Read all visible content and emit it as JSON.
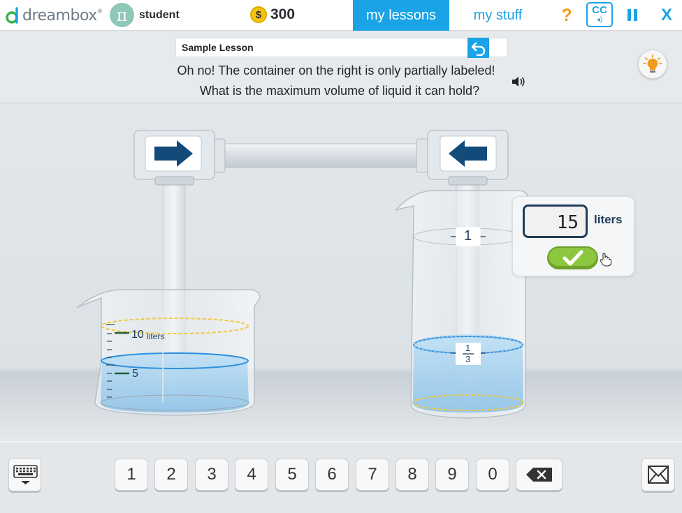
{
  "app": {
    "logo_text": "dreambox",
    "logo_tm": "®",
    "avatar_symbol": "π",
    "username": "student",
    "coin_symbol": "$",
    "coins": "300",
    "tabs": {
      "lessons": "my lessons",
      "stuff": "my stuff"
    },
    "help": "?",
    "cc_label": "CC",
    "close": "X"
  },
  "header": {
    "lesson_title": "Sample Lesson",
    "instruction_line1": "Oh no! The container on the right is only partially labeled!",
    "instruction_line2": "What is the maximum volume of liquid it can hold?"
  },
  "beakers": {
    "left": {
      "mark_top": "10",
      "mark_top_unit": "liters",
      "mark_mid": "5"
    },
    "right": {
      "mark_full": "1",
      "mark_fraction_num": "1",
      "mark_fraction_den": "3"
    }
  },
  "answer": {
    "value": "15",
    "unit": "liters"
  },
  "keypad": {
    "keys": [
      "1",
      "2",
      "3",
      "4",
      "5",
      "6",
      "7",
      "8",
      "9",
      "0"
    ]
  },
  "colors": {
    "accent": "#1aa3e6",
    "navy": "#1f3d5a",
    "check_green": "#8dc63f",
    "water": "#a9d4f0",
    "coin": "#f5c40f"
  },
  "icons": {
    "logo": "dreambox-d-icon",
    "undo": "undo-arrow-icon",
    "speaker": "speaker-icon",
    "hint": "lightbulb-icon",
    "check": "checkmark-icon",
    "backspace": "backspace-icon",
    "keyboard": "keyboard-icon",
    "send": "envelope-icon",
    "cursor": "hand-pointer-icon"
  }
}
